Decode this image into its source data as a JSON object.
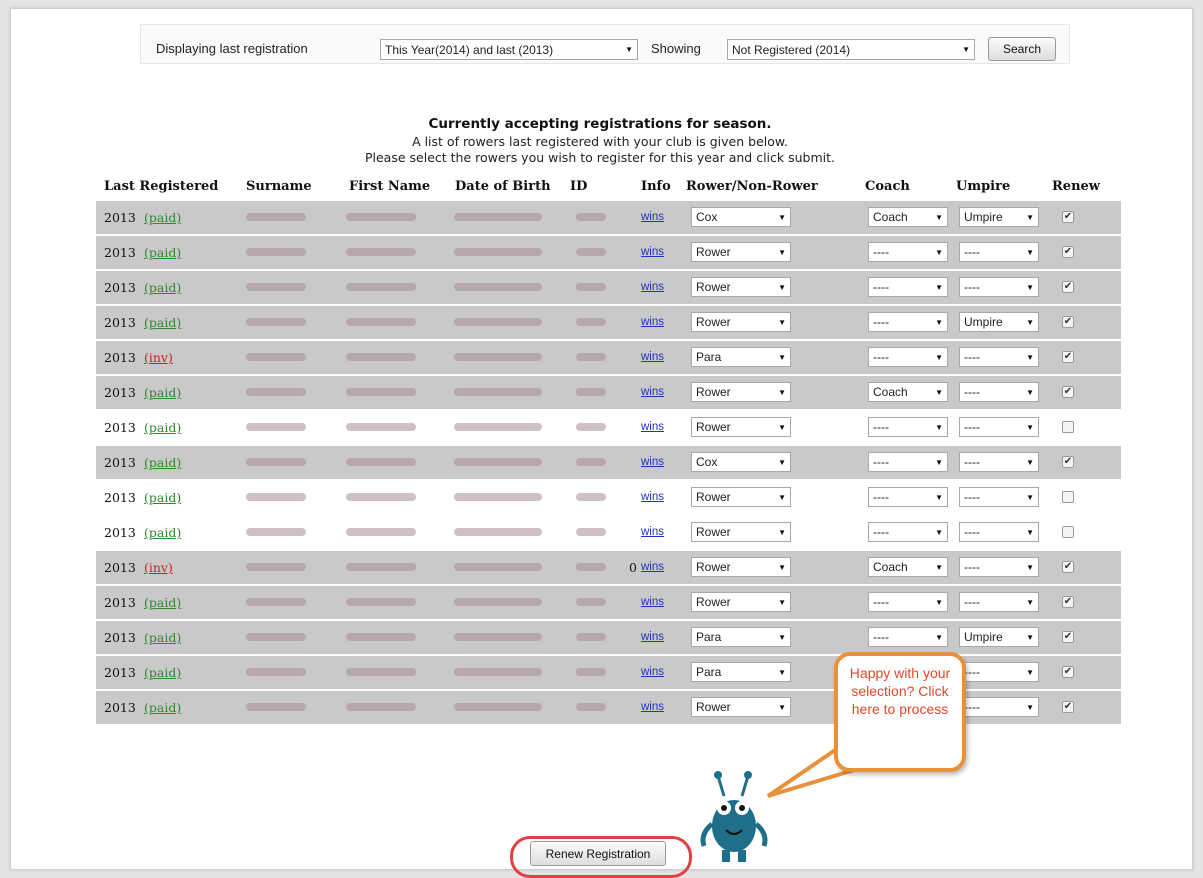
{
  "filter": {
    "display_label": "Displaying last registration",
    "display_value": "This Year(2014) and last (2013)",
    "showing_label": "Showing",
    "showing_value": "Not Registered (2014)",
    "search_label": "Search"
  },
  "intro": {
    "line1": "Currently accepting registrations for season.",
    "line2": "A list of rowers last registered with your club is given below.",
    "line3": "Please select the rowers you wish to register for this year and click submit."
  },
  "columns": [
    "Last Registered",
    "Surname",
    "First Name",
    "Date of Birth",
    "ID",
    "Info",
    "Rower/Non-Rower",
    "Coach",
    "Umpire",
    "Renew"
  ],
  "rows": [
    {
      "year": "2013",
      "status": "(paid)",
      "type": "paid",
      "role": "Cox",
      "coach": "Coach",
      "umpire": "Umpire",
      "renew": true,
      "shade": true
    },
    {
      "year": "2013",
      "status": "(paid)",
      "type": "paid",
      "role": "Rower",
      "coach": "----",
      "umpire": "----",
      "renew": true,
      "shade": true
    },
    {
      "year": "2013",
      "status": "(paid)",
      "type": "paid",
      "role": "Rower",
      "coach": "----",
      "umpire": "----",
      "renew": true,
      "shade": true
    },
    {
      "year": "2013",
      "status": "(paid)",
      "type": "paid",
      "role": "Rower",
      "coach": "----",
      "umpire": "Umpire",
      "renew": true,
      "shade": true
    },
    {
      "year": "2013",
      "status": "(inv)",
      "type": "inv",
      "role": "Para",
      "coach": "----",
      "umpire": "----",
      "renew": true,
      "shade": true
    },
    {
      "year": "2013",
      "status": "(paid)",
      "type": "paid",
      "role": "Rower",
      "coach": "Coach",
      "umpire": "----",
      "renew": true,
      "shade": true
    },
    {
      "year": "2013",
      "status": "(paid)",
      "type": "paid",
      "role": "Rower",
      "coach": "----",
      "umpire": "----",
      "renew": false,
      "shade": false
    },
    {
      "year": "2013",
      "status": "(paid)",
      "type": "paid",
      "role": "Cox",
      "coach": "----",
      "umpire": "----",
      "renew": true,
      "shade": true
    },
    {
      "year": "2013",
      "status": "(paid)",
      "type": "paid",
      "role": "Rower",
      "coach": "----",
      "umpire": "----",
      "renew": false,
      "shade": false
    },
    {
      "year": "2013",
      "status": "(paid)",
      "type": "paid",
      "role": "Rower",
      "coach": "----",
      "umpire": "----",
      "renew": false,
      "shade": false
    },
    {
      "year": "2013",
      "status": "(inv)",
      "type": "inv",
      "role": "Rower",
      "coach": "Coach",
      "umpire": "----",
      "renew": true,
      "shade": true
    },
    {
      "year": "2013",
      "status": "(paid)",
      "type": "paid",
      "role": "Rower",
      "coach": "----",
      "umpire": "----",
      "renew": true,
      "shade": true
    },
    {
      "year": "2013",
      "status": "(paid)",
      "type": "paid",
      "role": "Para",
      "coach": "----",
      "umpire": "Umpire",
      "renew": true,
      "shade": true
    },
    {
      "year": "2013",
      "status": "(paid)",
      "type": "paid",
      "role": "Para",
      "coach": "----",
      "umpire": "----",
      "renew": true,
      "shade": true
    },
    {
      "year": "2013",
      "status": "(paid)",
      "type": "paid",
      "role": "Rower",
      "coach": "----",
      "umpire": "----",
      "renew": true,
      "shade": true
    }
  ],
  "info_link": "wins",
  "id_partial": "0",
  "callout": "Happy with your selection? Click here to process",
  "renew_button": "Renew Registration",
  "colors": {
    "paid": "#2e8b2e",
    "inv": "#d02020",
    "callout_border": "#e8913a",
    "callout_text": "#e0472a",
    "ring": "#e04040",
    "mascot": "#1f6f8b"
  },
  "icons": [
    "chevron-down-icon",
    "checkbox-icon",
    "mascot-icon"
  ]
}
